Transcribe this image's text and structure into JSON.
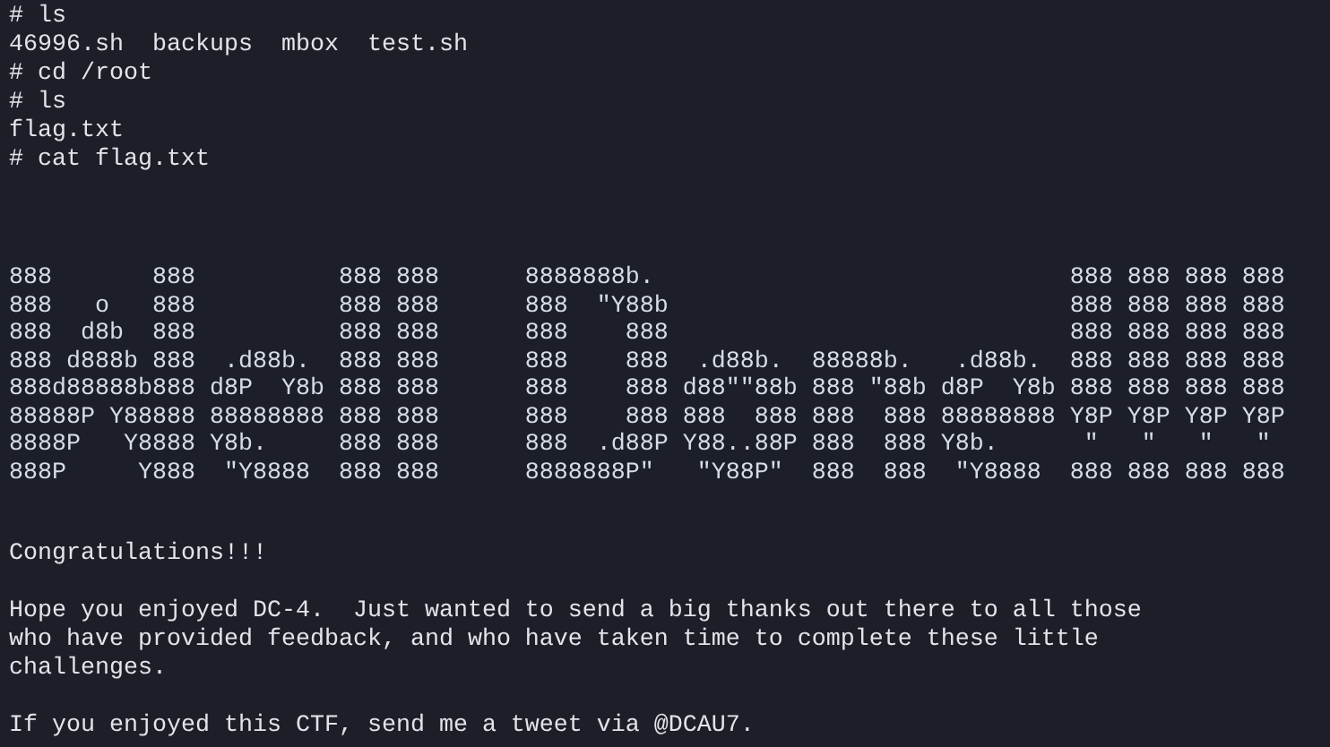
{
  "terminal": {
    "blocks": [
      {
        "kind": "shell",
        "lines": [
          "# ls",
          "46996.sh  backups  mbox  test.sh",
          "# cd /root",
          "# ls",
          "flag.txt",
          "# cat flag.txt"
        ]
      },
      {
        "kind": "banner",
        "lines": [
          "888       888          888 888      8888888b.                             888 888 888 888",
          "888   o   888          888 888      888  \"Y88b                            888 888 888 888",
          "888  d8b  888          888 888      888    888                            888 888 888 888",
          "888 d888b 888  .d88b.  888 888      888    888  .d88b.  88888b.   .d88b.  888 888 888 888",
          "888d88888b888 d8P  Y8b 888 888      888    888 d88\"\"88b 888 \"88b d8P  Y8b 888 888 888 888",
          "88888P Y88888 88888888 888 888      888    888 888  888 888  888 88888888 Y8P Y8P Y8P Y8P",
          "8888P   Y8888 Y8b.     888 888      888  .d88P Y88..88P 888  888 Y8b.      \"   \"   \"   \"",
          "888P     Y888  \"Y8888  888 888      8888888P\"   \"Y88P\"  888  888  \"Y8888  888 888 888 888"
        ]
      },
      {
        "kind": "text",
        "lines": [
          "Congratulations!!!"
        ]
      },
      {
        "kind": "text",
        "lines": [
          "Hope you enjoyed DC-4.  Just wanted to send a big thanks out there to all those",
          "who have provided feedback, and who have taken time to complete these little",
          "challenges."
        ]
      },
      {
        "kind": "text",
        "lines": [
          "If you enjoyed this CTF, send me a tweet via @DCAU7."
        ]
      }
    ]
  }
}
